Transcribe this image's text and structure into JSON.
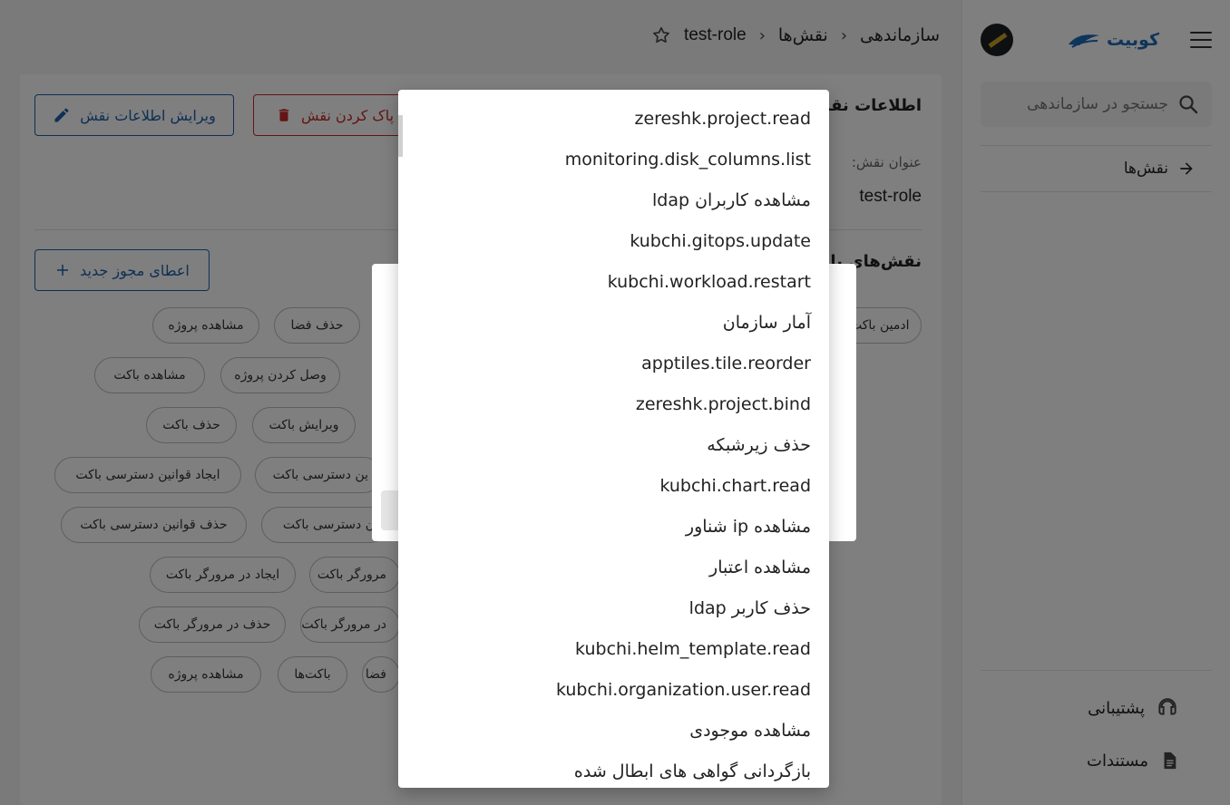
{
  "sidebar": {
    "logo_text": "کوبیت",
    "search_placeholder": "جستجو در سازماندهی",
    "nav_item": "نقش‌ها",
    "support": "پشتیبانی",
    "docs": "مستندات"
  },
  "breadcrumb": {
    "root": "سازماندهی",
    "roles": "نقش‌ها",
    "current": "test-role"
  },
  "role_info": {
    "title": "اطلاعات نقش",
    "edit_button": "ویرایش اطلاعات نقش",
    "delete_button": "پاک کردن نقش",
    "name_label": "عنوان نقش:",
    "name_value": "test-role"
  },
  "permissions": {
    "title": "نقش‌های پایه",
    "grant_button": "اعطای مجوز جدید",
    "chips": [
      "مشاهده پروژه",
      "حذف فضا",
      "ادمین باکت",
      "مشاهده باکت",
      "وصل کردن پروژه",
      "حذف باکت",
      "ویرایش باکت",
      "ایجاد قوانین دسترسی باکت",
      "ین دسترسی باکت",
      "حذف قوانین دسترسی باکت",
      "ن دسترسی باکت",
      "ایجاد در مرورگر باکت",
      "مرورگر باکت",
      "حذف در مرورگر باکت",
      "در مرورگر باکت",
      "مشاهده پروژه",
      "باکت‌ها",
      "فضا"
    ]
  },
  "dropdown": {
    "items": [
      "zereshk.project.read",
      "monitoring.disk_columns.list",
      "مشاهده کاربران ldap",
      "kubchi.gitops.update",
      "kubchi.workload.restart",
      "آمار سازمان",
      "apptiles.tile.reorder",
      "zereshk.project.bind",
      "حذف زیرشبکه",
      "kubchi.chart.read",
      "مشاهده ip شناور",
      "مشاهده اعتبار",
      "حذف کاربر ldap",
      "kubchi.helm_template.read",
      "kubchi.organization.user.read",
      "مشاهده موجودی",
      "بازگردانی گواهی های ابطال شده"
    ]
  },
  "colors": {
    "primary": "#1e5fa8",
    "danger": "#c62828",
    "overlay": "rgba(0,0,0,0.5)"
  }
}
